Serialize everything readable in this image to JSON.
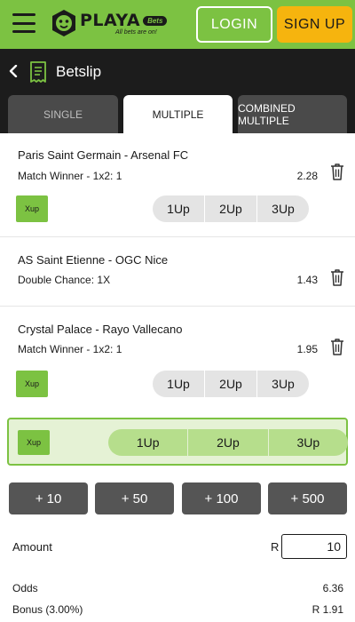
{
  "header": {
    "brand_name": "PLAYA",
    "brand_badge": "Bets",
    "tagline": "All bets are on!",
    "login_label": "LOGIN",
    "signup_label": "SIGN UP",
    "accent_color": "#7cc242",
    "signup_color": "#f6b40e"
  },
  "betslip": {
    "title": "Betslip",
    "tabs": [
      {
        "label": "SINGLE",
        "active": false
      },
      {
        "label": "MULTIPLE",
        "active": true
      },
      {
        "label": "COMBINED MULTIPLE",
        "active": false
      }
    ]
  },
  "bets": [
    {
      "match": "Paris Saint Germain - Arsenal FC",
      "market": "Match Winner - 1x2: 1",
      "odds": "2.28",
      "has_xup": true
    },
    {
      "match": "AS Saint Etienne - OGC Nice",
      "market": "Double Chance: 1X",
      "odds": "1.43",
      "has_xup": false
    },
    {
      "match": "Crystal Palace - Rayo Vallecano",
      "market": "Match Winner - 1x2: 1",
      "odds": "1.95",
      "has_xup": true
    }
  ],
  "xup": {
    "label": "Xup",
    "options": [
      "1Up",
      "2Up",
      "3Up"
    ]
  },
  "quick_amounts": [
    "+ 10",
    "+ 50",
    "+ 100",
    "+ 500"
  ],
  "amount": {
    "label": "Amount",
    "currency": "R",
    "value": "10"
  },
  "summary": {
    "odds_label": "Odds",
    "odds_value": "6.36",
    "bonus_label": "Bonus (3.00%)",
    "bonus_value": "R 1.91"
  }
}
